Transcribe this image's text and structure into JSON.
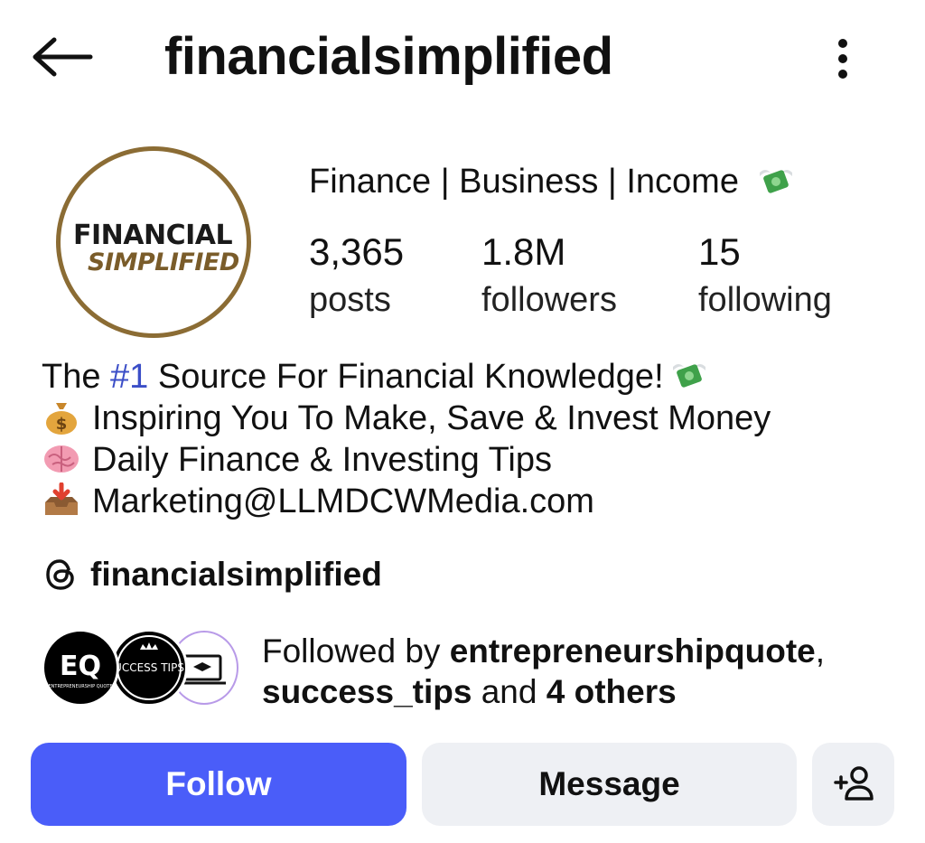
{
  "header": {
    "username": "financialsimplified",
    "back_icon": "arrow-left-icon",
    "more_icon": "vertical-dots-icon"
  },
  "profile": {
    "avatar_text_line1": "FINANCIAL",
    "avatar_text_line2": "SIMPLIFIED",
    "display_name": "Finance | Business | Income",
    "stats": [
      {
        "value": "3,365",
        "label": "posts"
      },
      {
        "value": "1.8M",
        "label": "followers"
      },
      {
        "value": "15",
        "label": "following"
      }
    ]
  },
  "bio": {
    "line1_pre": "The ",
    "line1_hashtag": "#1",
    "line1_post": " Source For Financial Knowledge!",
    "line2": "Inspiring You To Make, Save & Invest Money",
    "line3": "Daily Finance & Investing Tips",
    "line4": "Marketing@LLMDCWMedia.com",
    "emojis": [
      "money-with-wings-icon",
      "money-bag-icon",
      "brain-icon",
      "inbox-tray-icon"
    ]
  },
  "threads": {
    "handle": "financialsimplified",
    "icon": "threads-icon"
  },
  "mutuals": {
    "prefix": "Followed by ",
    "name1": "entrepreneurshipquote",
    "sep": ",",
    "name2": "success_tips",
    "middle": " and ",
    "others": "4 others",
    "avatar1_text": "ENTREPRENEURSHIP QUOTE",
    "avatar2_text": "UCCESS TIPS"
  },
  "actions": {
    "follow_label": "Follow",
    "message_label": "Message",
    "add_user_icon": "add-person-icon"
  },
  "colors": {
    "follow_bg": "#4a5df9",
    "secondary_btn_bg": "#eef0f4",
    "hashtag": "#3b4ec7",
    "avatar_ring": "#8b6c34"
  }
}
